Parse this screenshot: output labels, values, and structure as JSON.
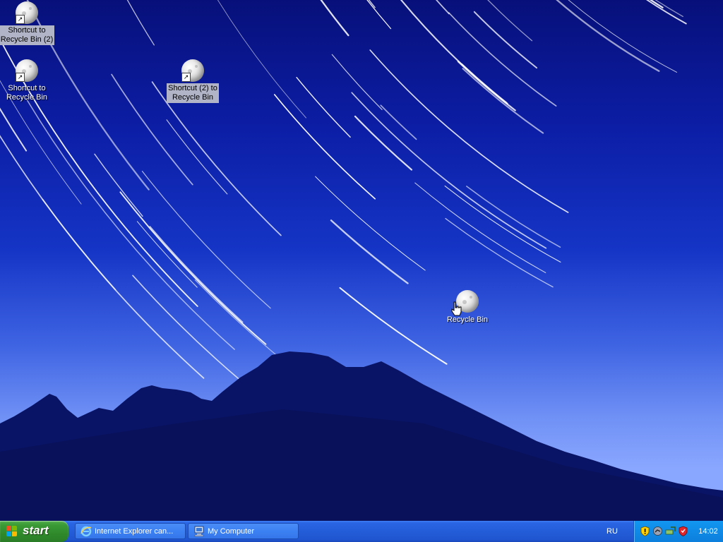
{
  "desktop": {
    "icons": [
      {
        "id": "shortcut-recycle-bin-2",
        "line1": "Shortcut to",
        "line2": "Recycle Bin (2)",
        "shortcut": true,
        "selected": true
      },
      {
        "id": "shortcut-recycle-bin",
        "line1": "Shortcut to",
        "line2": "Recycle Bin",
        "shortcut": true,
        "selected": false
      },
      {
        "id": "shortcut-2-recycle-bin",
        "line1": "Shortcut (2) to",
        "line2": "Recycle Bin",
        "shortcut": true,
        "selected": true
      },
      {
        "id": "recycle-bin",
        "line1": "Recycle Bin",
        "line2": "",
        "shortcut": false,
        "selected": false
      }
    ],
    "icon_image": "moon-icon"
  },
  "taskbar": {
    "start_label": "start",
    "tasks": [
      {
        "label": "Internet Explorer can...",
        "icon": "internet-explorer-icon"
      },
      {
        "label": "My Computer",
        "icon": "my-computer-icon"
      }
    ],
    "language": "RU",
    "tray_icons": [
      "security-alert-icon",
      "network-icon",
      "safely-remove-icon",
      "antivirus-shield-icon"
    ],
    "clock": "14:02"
  },
  "colors": {
    "taskbar_blue": "#245dd8",
    "start_green": "#3b9a35",
    "tray_blue": "#0f8ae6"
  }
}
